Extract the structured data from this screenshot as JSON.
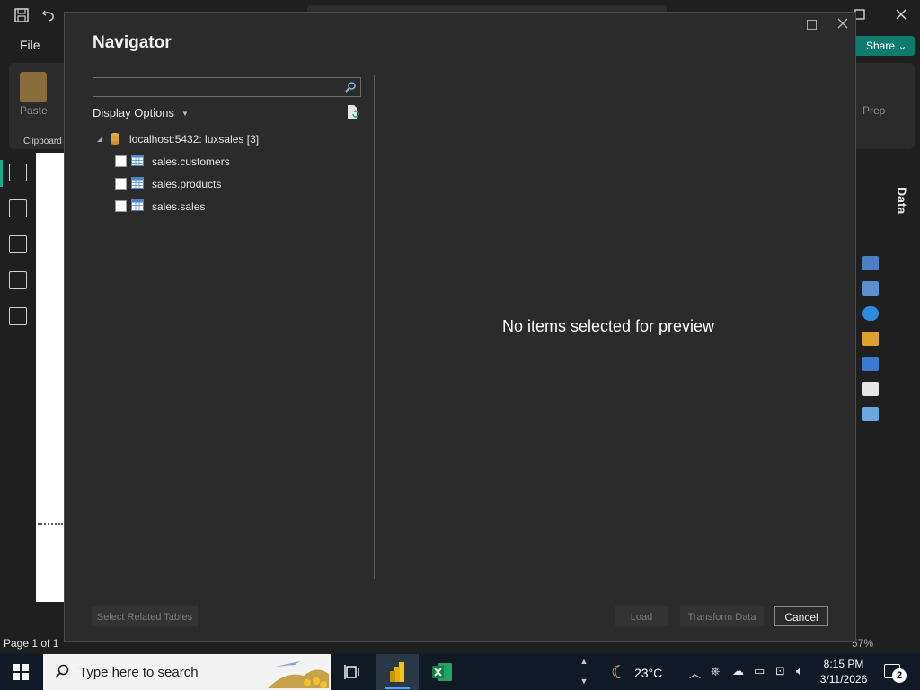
{
  "app": {
    "menu_file": "File",
    "share_label": "Share",
    "ribbon": {
      "paste_label": "Paste",
      "clipboard_label": "Clipboard",
      "prep_label": "Prep"
    },
    "right_panel_tab": "Data",
    "status": {
      "page_label": "Page 1 of 1",
      "zoom_label": "57%"
    }
  },
  "dialog": {
    "title": "Navigator",
    "search": {
      "value": "",
      "placeholder": ""
    },
    "display_options_label": "Display Options",
    "tree": {
      "root_label": "localhost:5432: luxsales [3]",
      "items": [
        {
          "label": "sales.customers",
          "checked": false
        },
        {
          "label": "sales.products",
          "checked": false
        },
        {
          "label": "sales.sales",
          "checked": false
        }
      ]
    },
    "preview_message": "No items selected for preview",
    "buttons": {
      "select_related": "Select Related Tables",
      "load": "Load",
      "transform": "Transform Data",
      "cancel": "Cancel"
    }
  },
  "taskbar": {
    "search_placeholder": "Type here to search",
    "weather_temp": "23°C",
    "time": "8:15 PM",
    "date": "3/11/2026",
    "notification_count": "2"
  },
  "colors": {
    "accent": "#1aab8a",
    "share_button": "#0f7b6c",
    "dialog_bg": "#2b2b2b",
    "taskbar_bg": "#101a26"
  }
}
